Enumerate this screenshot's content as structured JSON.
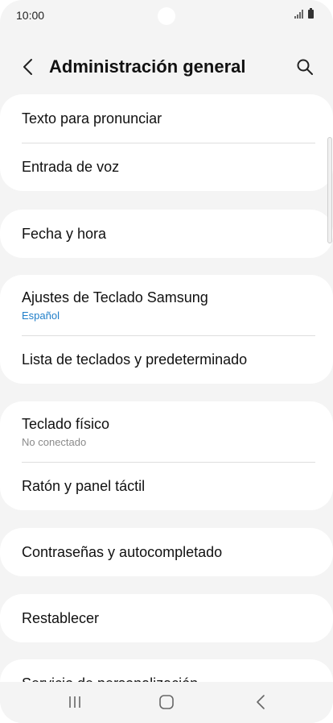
{
  "status_bar": {
    "time": "10:00"
  },
  "header": {
    "title": "Administración general"
  },
  "groups": [
    {
      "items": [
        {
          "label": "Texto para pronunciar"
        },
        {
          "label": "Entrada de voz"
        }
      ]
    },
    {
      "items": [
        {
          "label": "Fecha y hora"
        }
      ]
    },
    {
      "items": [
        {
          "label": "Ajustes de Teclado Samsung",
          "sub": "Español"
        },
        {
          "label": "Lista de teclados y predeterminado"
        }
      ]
    },
    {
      "items": [
        {
          "label": "Teclado físico",
          "sub": "No conectado"
        },
        {
          "label": "Ratón y panel táctil"
        }
      ]
    },
    {
      "items": [
        {
          "label": "Contraseñas y autocompletado"
        }
      ]
    },
    {
      "items": [
        {
          "label": "Restablecer"
        }
      ]
    },
    {
      "items": [
        {
          "label": "Servicio de personalización"
        }
      ]
    }
  ],
  "icons": {
    "back": "chevron-left-icon",
    "search": "search-icon",
    "nav_recents": "recents-icon",
    "nav_home": "home-icon",
    "nav_back": "back-icon"
  },
  "colors": {
    "background": "#f4f4f4",
    "card": "#ffffff",
    "accent_sub": "#1f7ec9",
    "grey_sub": "#8a8a8a"
  }
}
